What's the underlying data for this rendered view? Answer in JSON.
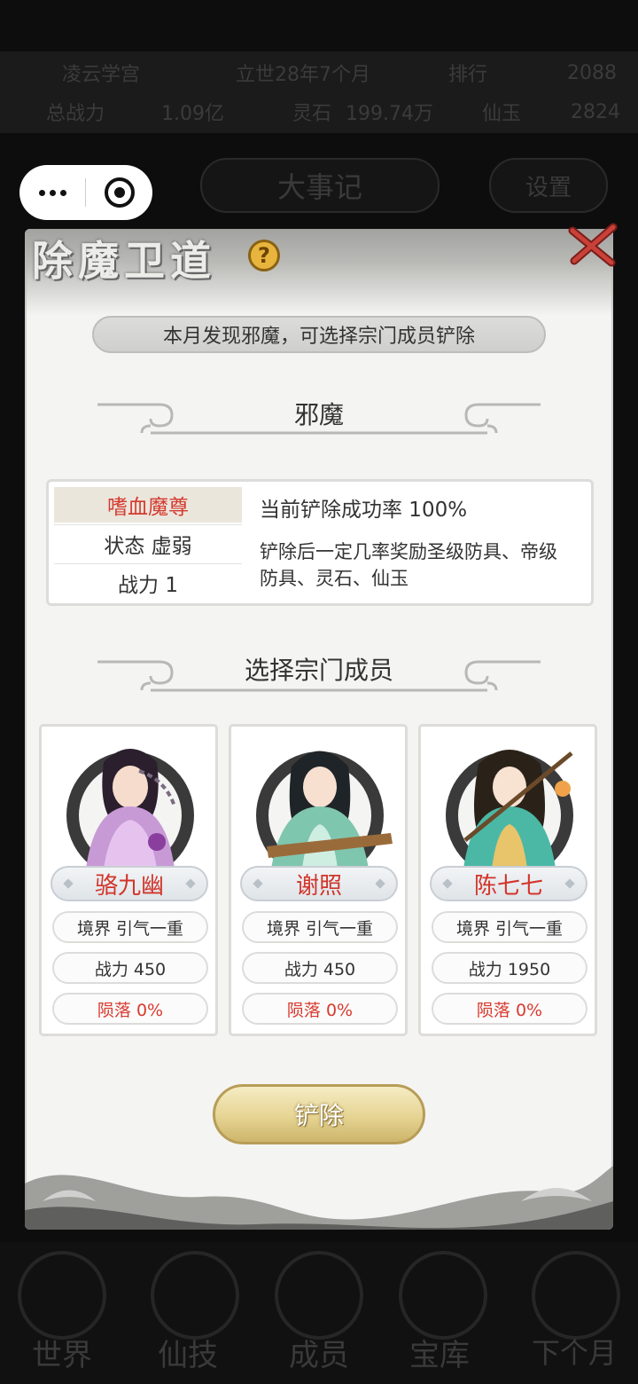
{
  "background": {
    "stats_row1": [
      "凌云学宫",
      "立世28年7个月",
      "排行",
      "2088"
    ],
    "stats_row2": [
      "总战力",
      "1.09亿",
      "灵石",
      "199.74万",
      "仙玉",
      "2824"
    ],
    "center_button": "大事记",
    "right_button": "设置",
    "bottom_nav": [
      "世界",
      "仙技",
      "成员",
      "宝库",
      "下个月"
    ]
  },
  "dialog": {
    "title": "除魔卫道",
    "help_symbol": "?",
    "subtitle": "本月发现邪魔，可选择宗门成员铲除",
    "evil_section_title": "邪魔",
    "evil": {
      "name": "嗜血魔尊",
      "status": "状态 虚弱",
      "power": "战力 1",
      "success_rate": "当前铲除成功率 100%",
      "reward": "铲除后一定几率奖励圣级防具、帝级防具、灵石、仙玉"
    },
    "members_section_title": "选择宗门成员",
    "members": [
      {
        "name": "骆九幽",
        "realm": "境界  引气一重",
        "power": "战力 450",
        "death": "陨落 0%"
      },
      {
        "name": "谢照",
        "realm": "境界  引气一重",
        "power": "战力 450",
        "death": "陨落 0%"
      },
      {
        "name": "陈七七",
        "realm": "境界  引气一重",
        "power": "战力 1950",
        "death": "陨落 0%"
      }
    ],
    "action_label": "铲除"
  },
  "colors": {
    "accent_red": "#d43a2e",
    "gold_button": "#e6d493",
    "help_icon": "#e7b53e"
  }
}
